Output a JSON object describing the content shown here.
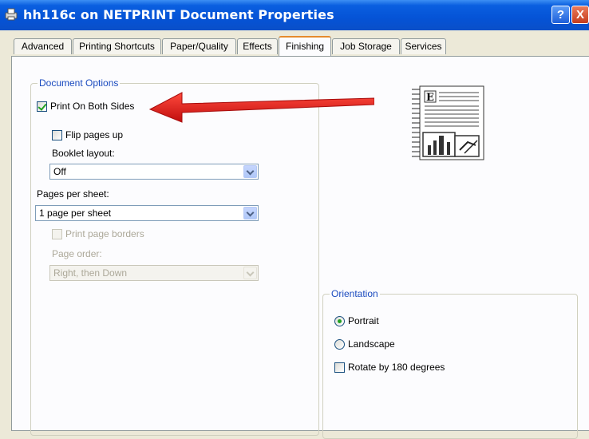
{
  "window": {
    "title": "hh116c on NETPRINT Document Properties",
    "help_label": "?",
    "close_label": "X"
  },
  "tabs": [
    {
      "label": "Advanced"
    },
    {
      "label": "Printing Shortcuts"
    },
    {
      "label": "Paper/Quality"
    },
    {
      "label": "Effects"
    },
    {
      "label": "Finishing"
    },
    {
      "label": "Job Storage"
    },
    {
      "label": "Services"
    }
  ],
  "active_tab": "Finishing",
  "document_options": {
    "title": "Document Options",
    "print_both_sides": {
      "label": "Print On Both Sides",
      "checked": true
    },
    "flip_pages_up": {
      "label": "Flip pages up",
      "checked": false
    },
    "booklet_layout": {
      "label": "Booklet layout:",
      "value": "Off"
    },
    "pages_per_sheet": {
      "label": "Pages per sheet:",
      "value": "1 page per sheet"
    },
    "print_page_borders": {
      "label": "Print page borders",
      "checked": false,
      "disabled": true
    },
    "page_order": {
      "label": "Page order:",
      "value": "Right, then Down",
      "disabled": true
    }
  },
  "orientation": {
    "title": "Orientation",
    "portrait": {
      "label": "Portrait",
      "selected": true
    },
    "landscape": {
      "label": "Landscape",
      "selected": false
    },
    "rotate_180": {
      "label": "Rotate by 180 degrees",
      "checked": false
    }
  },
  "colors": {
    "title_bar": "#0553d6",
    "group_title": "#1b4bbf",
    "active_tab_accent": "#e68b2c",
    "annotation_arrow": "#e01515"
  }
}
